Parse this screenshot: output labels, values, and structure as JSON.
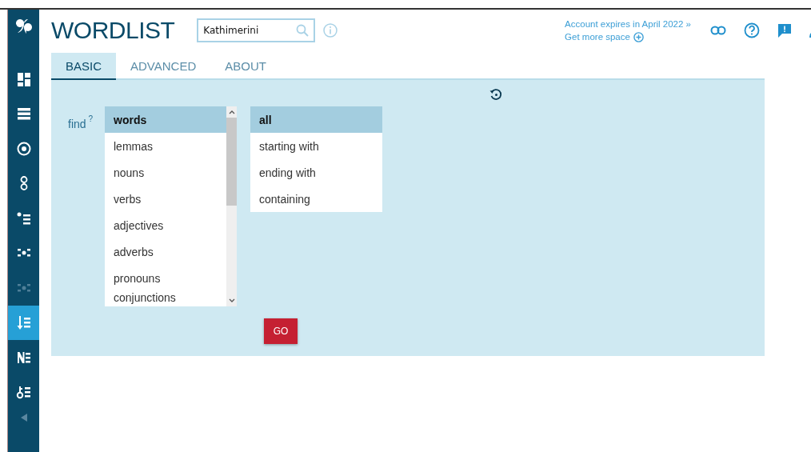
{
  "app": {
    "title": "WORDLIST"
  },
  "search": {
    "value": "Kathimerini"
  },
  "account": {
    "expiry_link": "Account expires in April 2022 »",
    "space_link": "Get more space"
  },
  "sidebar": {
    "items": [
      {
        "kind": "dashboard",
        "selected": false,
        "disabled": false
      },
      {
        "kind": "list",
        "selected": false,
        "disabled": false
      },
      {
        "kind": "target",
        "selected": false,
        "disabled": false
      },
      {
        "kind": "rings",
        "selected": false,
        "disabled": false
      },
      {
        "kind": "bullets",
        "selected": false,
        "disabled": false
      },
      {
        "kind": "dots",
        "selected": false,
        "disabled": false
      },
      {
        "kind": "dots",
        "selected": false,
        "disabled": true
      },
      {
        "kind": "sort",
        "selected": true,
        "disabled": false
      },
      {
        "kind": "nlist",
        "selected": false,
        "disabled": false
      },
      {
        "kind": "keylist",
        "selected": false,
        "disabled": false
      }
    ]
  },
  "tabs": [
    {
      "label": "BASIC",
      "selected": true
    },
    {
      "label": "ADVANCED",
      "selected": false
    },
    {
      "label": "ABOUT",
      "selected": false
    }
  ],
  "form": {
    "find_label": "find",
    "help_mark": "?",
    "types": [
      {
        "label": "words",
        "selected": true
      },
      {
        "label": "lemmas",
        "selected": false
      },
      {
        "label": "nouns",
        "selected": false
      },
      {
        "label": "verbs",
        "selected": false
      },
      {
        "label": "adjectives",
        "selected": false
      },
      {
        "label": "adverbs",
        "selected": false
      },
      {
        "label": "pronouns",
        "selected": false
      },
      {
        "label": "conjunctions",
        "selected": false
      }
    ],
    "matches": [
      {
        "label": "all",
        "selected": true
      },
      {
        "label": "starting with",
        "selected": false
      },
      {
        "label": "ending with",
        "selected": false
      },
      {
        "label": "containing",
        "selected": false
      }
    ],
    "go_button": "GO"
  }
}
